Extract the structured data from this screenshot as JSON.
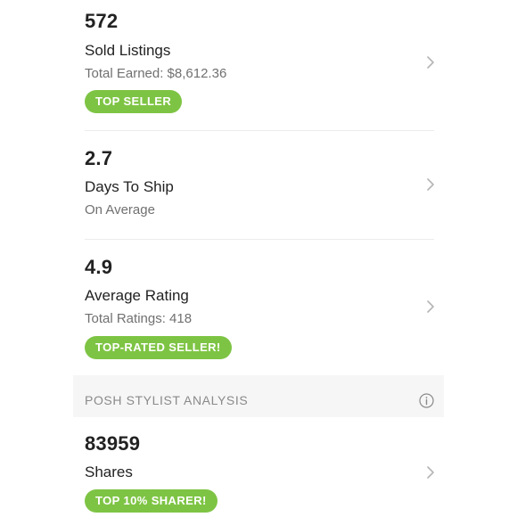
{
  "stats": [
    {
      "value": "572",
      "title": "Sold Listings",
      "subtitle": "Total Earned: $8,612.36",
      "badge": "TOP SELLER"
    },
    {
      "value": "2.7",
      "title": "Days To Ship",
      "subtitle": "On Average"
    },
    {
      "value": "4.9",
      "title": "Average Rating",
      "subtitle": "Total Ratings: 418",
      "badge": "TOP-RATED SELLER!"
    }
  ],
  "analysis_section": {
    "label": "POSH STYLIST ANALYSIS",
    "icon": "info-icon"
  },
  "shares": {
    "value": "83959",
    "title": "Shares",
    "badge": "TOP 10% SHARER!"
  },
  "colors": {
    "badge_green": "#7ec444",
    "text_dark": "#222222",
    "text_muted": "#707070",
    "section_bg": "#f6f6f6"
  }
}
